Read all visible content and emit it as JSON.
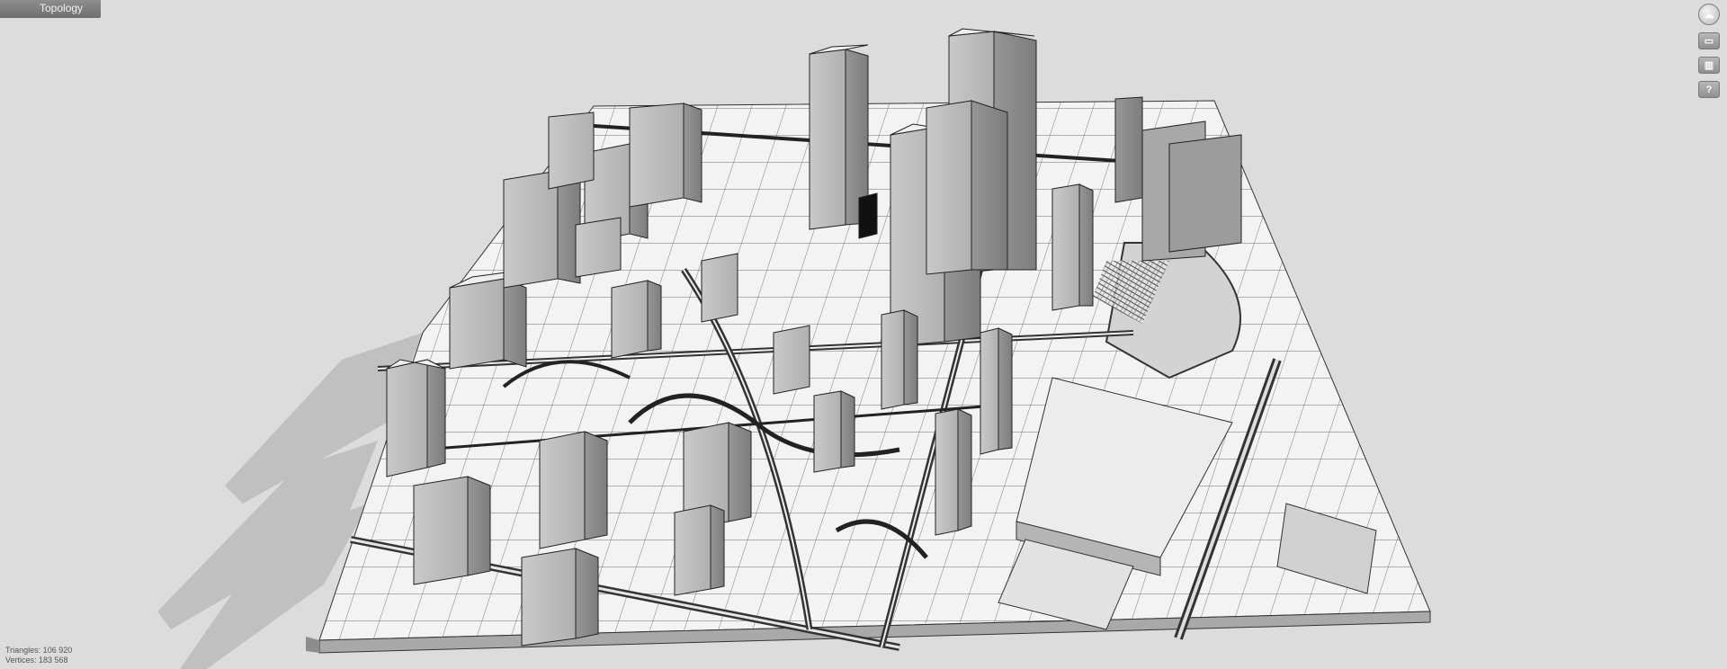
{
  "header": {
    "title": "Topology"
  },
  "toolbar": {
    "items": [
      {
        "icon": "app-logo-icon"
      },
      {
        "icon": "layers-icon"
      },
      {
        "icon": "render-style-icon"
      },
      {
        "icon": "help-icon",
        "label": "?"
      }
    ]
  },
  "stats": {
    "triangles": "Triangles: 106 920",
    "vertices": "Vertices: 183 568"
  }
}
